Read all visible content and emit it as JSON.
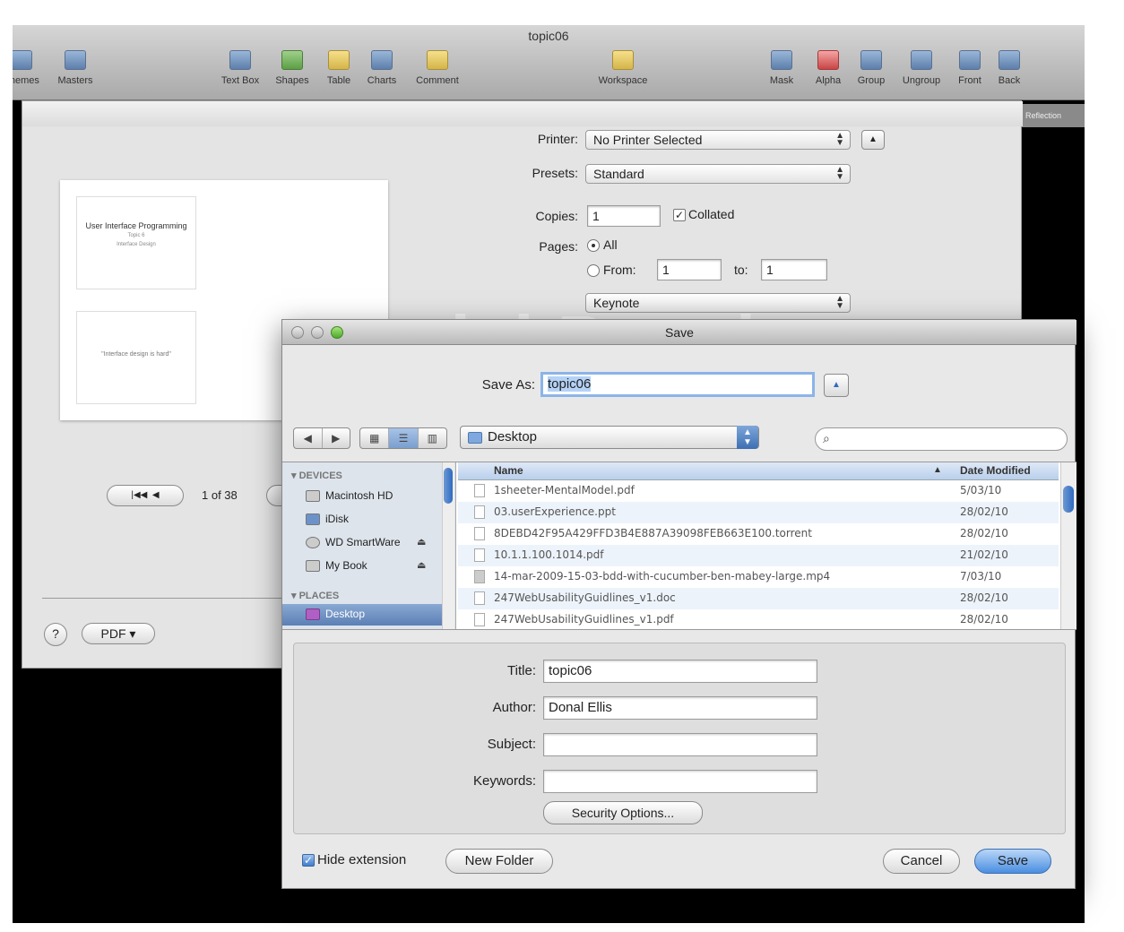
{
  "window": {
    "title": "topic06",
    "toolbar": [
      {
        "label": "Themes",
        "icon": "themes-icon"
      },
      {
        "label": "Masters",
        "icon": "masters-icon"
      },
      {
        "label": "Text Box",
        "icon": "text-box-icon"
      },
      {
        "label": "Shapes",
        "icon": "shapes-icon"
      },
      {
        "label": "Table",
        "icon": "table-icon"
      },
      {
        "label": "Charts",
        "icon": "charts-icon"
      },
      {
        "label": "Comment",
        "icon": "comment-icon"
      },
      {
        "label": "Workspace",
        "icon": "workspace-icon"
      },
      {
        "label": "Mask",
        "icon": "mask-icon"
      },
      {
        "label": "Alpha",
        "icon": "alpha-icon"
      },
      {
        "label": "Group",
        "icon": "group-icon"
      },
      {
        "label": "Ungroup",
        "icon": "ungroup-icon"
      },
      {
        "label": "Front",
        "icon": "front-icon"
      },
      {
        "label": "Back",
        "icon": "back-icon"
      }
    ],
    "reflection_label": "Reflection"
  },
  "print": {
    "printer_label": "Printer:",
    "printer_value": "No Printer Selected",
    "presets_label": "Presets:",
    "presets_value": "Standard",
    "copies_label": "Copies:",
    "copies_value": "1",
    "collated_label": "Collated",
    "pages_label": "Pages:",
    "pages_all_label": "All",
    "pages_from_label": "From:",
    "from_value": "1",
    "to_label": "to:",
    "to_value": "1",
    "section_value": "Keynote",
    "watermark": "odal Panel",
    "page_indicator": "1 of 38",
    "pdf_label": "PDF ▾",
    "help_label": "?",
    "slide1_title": "User Interface Programming",
    "slide1_topic": "Topic 6",
    "slide1_topic_name": "Interface Design",
    "slide2_text": "\"Interface design is hard\""
  },
  "save_dialog": {
    "title": "Save",
    "save_as_label": "Save As:",
    "save_as_value": "topic06",
    "location": "Desktop",
    "search_placeholder": "",
    "sidebar": {
      "devices_header": "DEVICES",
      "places_header": "PLACES",
      "devices": [
        "Macintosh HD",
        "iDisk",
        "WD SmartWare",
        "My Book"
      ],
      "places": [
        "Desktop"
      ]
    },
    "columns": {
      "name": "Name",
      "date": "Date Modified"
    },
    "files": [
      {
        "name": "1sheeter-MentalModel.pdf",
        "date": "5/03/10"
      },
      {
        "name": "03.userExperience.ppt",
        "date": "28/02/10"
      },
      {
        "name": "8DEBD42F95A429FFD3B4E887A39098FEB663E100.torrent",
        "date": "28/02/10"
      },
      {
        "name": "10.1.1.100.1014.pdf",
        "date": "21/02/10"
      },
      {
        "name": "14-mar-2009-15-03-bdd-with-cucumber-ben-mabey-large.mp4",
        "date": "7/03/10"
      },
      {
        "name": "247WebUsabilityGuidlines_v1.doc",
        "date": "28/02/10"
      },
      {
        "name": "247WebUsabilityGuidlines_v1.pdf",
        "date": "28/02/10"
      }
    ],
    "meta": {
      "title_label": "Title:",
      "title_value": "topic06",
      "author_label": "Author:",
      "author_value": "Donal Ellis",
      "subject_label": "Subject:",
      "subject_value": "",
      "keywords_label": "Keywords:",
      "keywords_value": "",
      "security_label": "Security Options..."
    },
    "hide_extension_label": "Hide extension",
    "new_folder_label": "New Folder",
    "cancel_label": "Cancel",
    "save_label": "Save"
  },
  "colors": {
    "accent": "#4a8ee1",
    "selection": "#b4d2f6",
    "sidebar_bg": "#dde4ec"
  }
}
